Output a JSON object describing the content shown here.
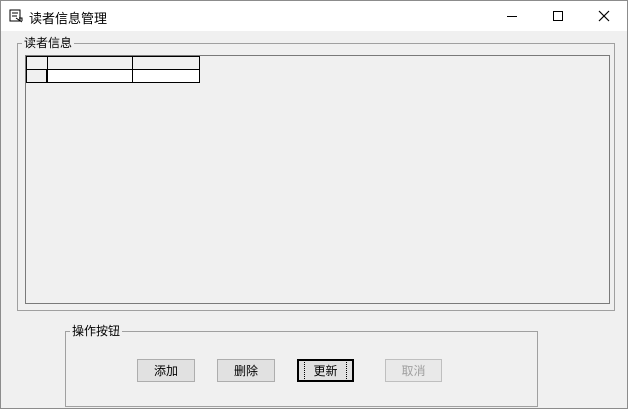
{
  "window": {
    "title": "读者信息管理",
    "icon": "form-icon",
    "controls": [
      "minimize-icon",
      "maximize-icon",
      "close-icon"
    ]
  },
  "reader_group": {
    "label": "读者信息",
    "grid": {
      "columns": [
        "",
        ""
      ],
      "rows": [
        [
          "",
          ""
        ]
      ]
    }
  },
  "op_group": {
    "label": "操作按钮",
    "buttons": {
      "add": "添加",
      "delete": "删除",
      "update": "更新",
      "cancel": "取消"
    },
    "cancel_enabled": false,
    "focused": "update"
  },
  "colors": {
    "face": "#f0f0f0",
    "button": "#e1e1e1",
    "disabled_text": "#a0a0a0"
  }
}
